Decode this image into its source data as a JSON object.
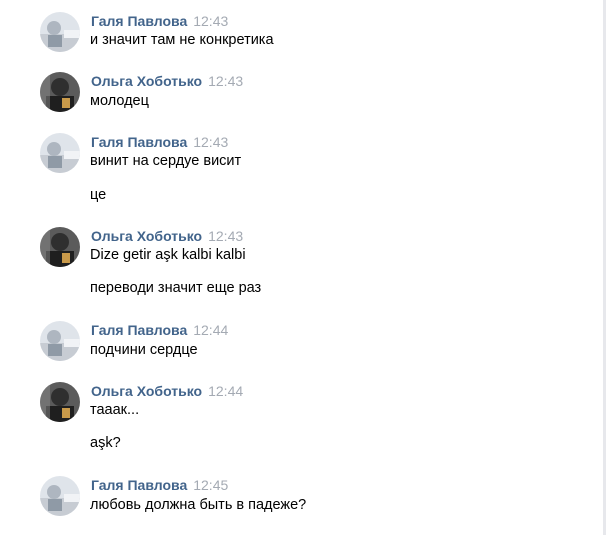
{
  "messages": [
    {
      "author": "Галя Павлова",
      "time": "12:43",
      "avatar": "user-photo-light",
      "lines": [
        "и значит там не конкретика"
      ]
    },
    {
      "author": "Ольга Хоботько",
      "time": "12:43",
      "avatar": "user-photo-dark",
      "lines": [
        "молодец"
      ]
    },
    {
      "author": "Галя Павлова",
      "time": "12:43",
      "avatar": "user-photo-light",
      "lines": [
        "винит на сердуе висит",
        "це"
      ]
    },
    {
      "author": "Ольга Хоботько",
      "time": "12:43",
      "avatar": "user-photo-dark",
      "lines": [
        "Dize getir aşk kalbi kalbi",
        "переводи значит еще раз"
      ]
    },
    {
      "author": "Галя Павлова",
      "time": "12:44",
      "avatar": "user-photo-light",
      "lines": [
        "подчини сердце"
      ]
    },
    {
      "author": "Ольга Хоботько",
      "time": "12:44",
      "avatar": "user-photo-dark",
      "lines": [
        "тааак...",
        "aşk?"
      ]
    },
    {
      "author": "Галя Павлова",
      "time": "12:45",
      "avatar": "user-photo-light",
      "lines": [
        "любовь должна быть в падеже?"
      ]
    }
  ],
  "colors": {
    "author": "#42648b",
    "time": "#a4aab3",
    "text": "#000000"
  }
}
